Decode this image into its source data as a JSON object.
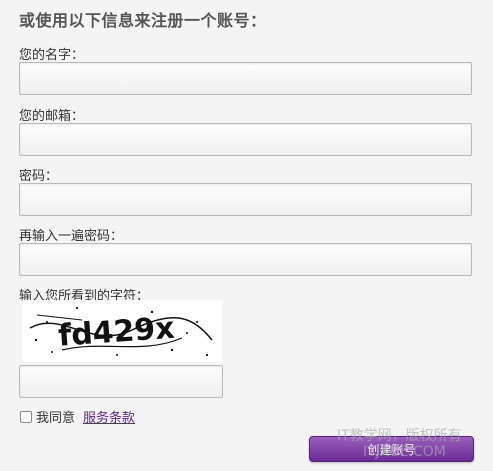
{
  "form": {
    "title": "或使用以下信息来注册一个账号：",
    "name_label": "您的名字：",
    "email_label": "您的邮箱：",
    "password_label": "密码：",
    "confirm_label": "再输入一遍密码：",
    "captcha_label": "输入您所看到的字符：",
    "captcha_text": "fd429x",
    "agree_text": "我同意",
    "terms_link": "服务条款",
    "submit_label": "创建账号"
  },
  "watermark": {
    "line1": "IT教学网，版权所有",
    "line2": "ITJXUE.COM"
  }
}
